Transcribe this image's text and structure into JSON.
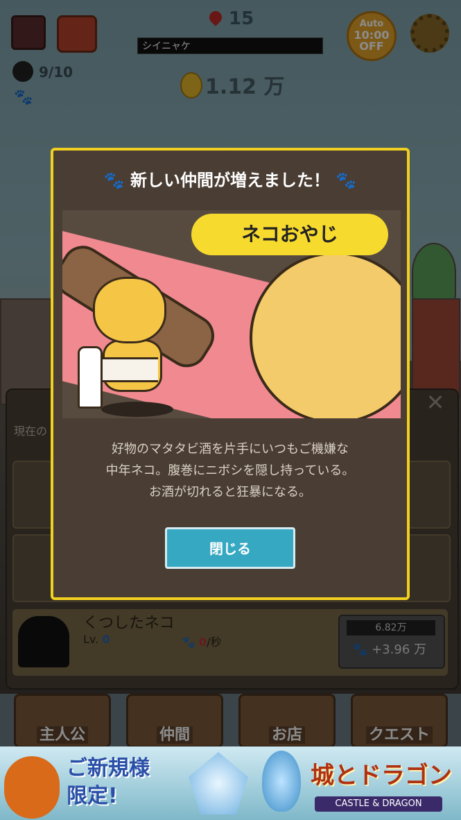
{
  "hud": {
    "level": "15",
    "player_name": "シイニャケ",
    "auto": {
      "line1": "Auto",
      "line2": "10:00",
      "line3": "OFF"
    },
    "cat_count": "9/10",
    "money": "1.12 万"
  },
  "panel": {
    "title": "現在の",
    "last_row": {
      "name": "くつしたネコ",
      "lv_label": "Lv.",
      "lv_value": "0",
      "rate_value": "0",
      "rate_unit": "/秒",
      "cost": "6.82万",
      "gain": "+3.96 万"
    }
  },
  "nav": {
    "hero": "主人公",
    "friends": "仲間",
    "shop": "お店",
    "quest": "クエスト"
  },
  "ad": {
    "headline_1": "ご新規様",
    "headline_2": "限定!",
    "logo": "城とドラゴン",
    "subtitle": "CASTLE & DRAGON"
  },
  "modal": {
    "title": "新しい仲間が増えました！",
    "cat_name": "ネコおやじ",
    "description_1": "好物のマタタビ酒を片手にいつもご機嫌な",
    "description_2": "中年ネコ。腹巻にニボシを隠し持っている。",
    "description_3": "お酒が切れると狂暴になる。",
    "close_label": "閉じる"
  },
  "colors": {
    "modal_border": "#f1d020",
    "modal_bg": "#4a3d33",
    "button": "#36a8c2",
    "bubble": "#f7da2e"
  }
}
